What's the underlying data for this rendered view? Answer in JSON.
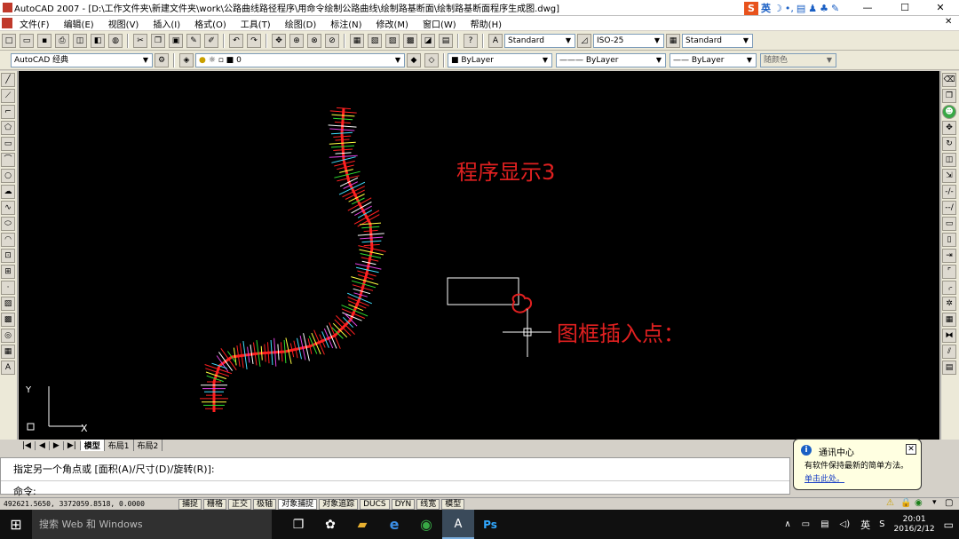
{
  "title_bar": {
    "title": "AutoCAD 2007 - [D:\\工作文件夹\\新建文件夹\\work\\公路曲线路径程序\\用命令绘制公路曲线\\绘制路基断面\\绘制路基断面程序生成图.dwg]",
    "minimize": "—",
    "maximize": "☐",
    "close": "✕"
  },
  "ime_bar": {
    "logo": "S",
    "mode": "英"
  },
  "menu": [
    "文件(F)",
    "编辑(E)",
    "视图(V)",
    "插入(I)",
    "格式(O)",
    "工具(T)",
    "绘图(D)",
    "标注(N)",
    "修改(M)",
    "窗口(W)",
    "帮助(H)"
  ],
  "toolbar_styles": {
    "text_style": "Standard",
    "dim_style": "ISO-25",
    "table_style": "Standard"
  },
  "toolbar_layers": {
    "workspace": "AutoCAD 经典",
    "layer": "0",
    "color": "ByLayer",
    "linetype": "ByLayer",
    "lineweight": "ByLayer",
    "plot_style": "随颜色"
  },
  "canvas": {
    "label_program": "程序显示3",
    "label_insert": "图框插入点：",
    "ucs_x": "X",
    "ucs_y": "Y",
    "colors": {
      "bg": "#000000",
      "label": "#e02020",
      "road": "#ff2020"
    }
  },
  "tabs": [
    "模型",
    "布局1",
    "布局2"
  ],
  "command": {
    "line1": "指定另一个角点或 [面积(A)/尺寸(D)/旋转(R)]:",
    "line2": "命令:"
  },
  "status": {
    "coords": "492621.5650, 3372059.8518, 0.0000",
    "buttons": [
      "捕捉",
      "栅格",
      "正交",
      "极轴",
      "对象捕捉",
      "对象追踪",
      "DUCS",
      "DYN",
      "线宽",
      "模型"
    ]
  },
  "popup": {
    "title": "通讯中心",
    "body": "有软件保持最新的简单方法。",
    "link": "单击此处。"
  },
  "taskbar": {
    "search": "搜索 Web 和 Windows",
    "time": "20:01",
    "date": "2016/2/12",
    "lang": "英"
  }
}
